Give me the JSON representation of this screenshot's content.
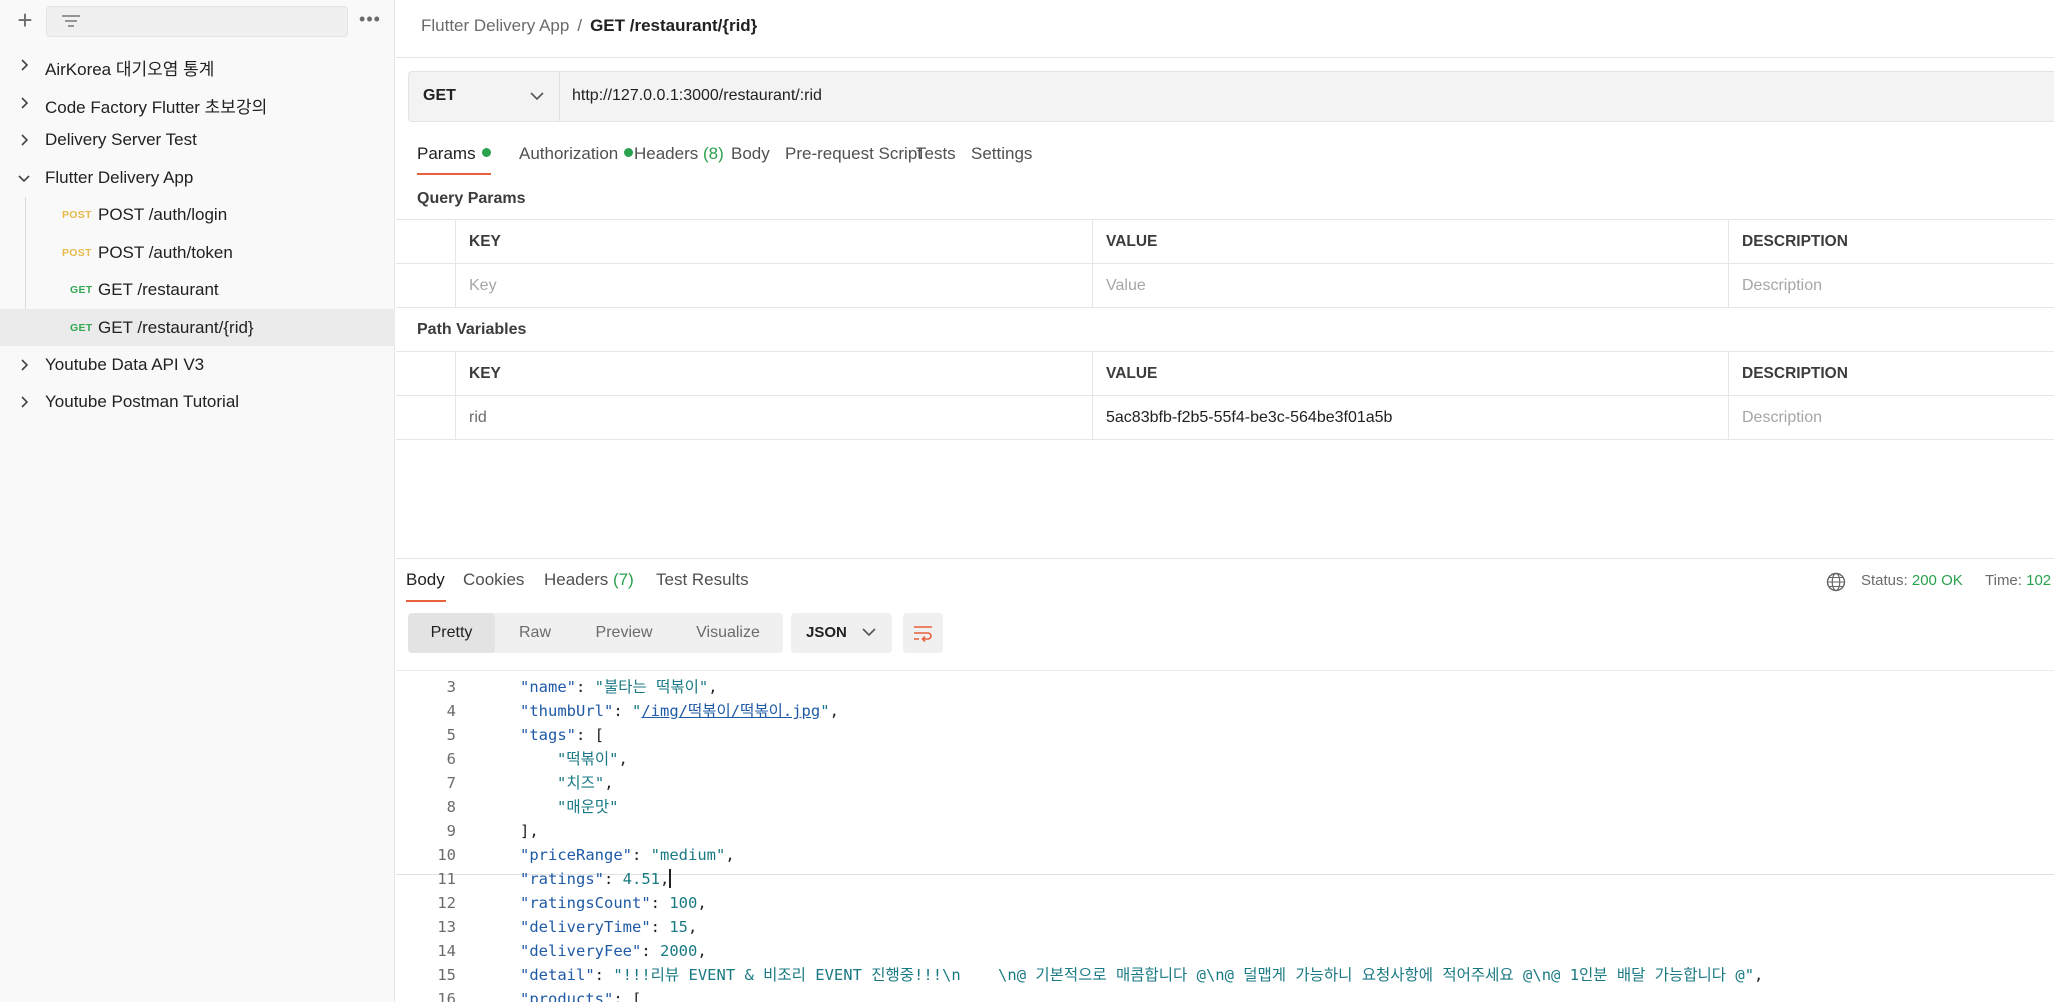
{
  "sidebar": {
    "collections": [
      {
        "label": "AirKorea 대기오염 통계"
      },
      {
        "label": "Code Factory Flutter 초보강의"
      },
      {
        "label": "Delivery Server Test"
      },
      {
        "label": "Flutter Delivery App"
      },
      {
        "label": "Youtube Data API V3"
      },
      {
        "label": "Youtube Postman Tutorial"
      }
    ],
    "requests": [
      {
        "method": "POST",
        "label": "POST /auth/login"
      },
      {
        "method": "POST",
        "label": "POST /auth/token"
      },
      {
        "method": "GET",
        "label": "GET /restaurant"
      },
      {
        "method": "GET",
        "label": "GET /restaurant/{rid}"
      }
    ]
  },
  "breadcrumb": {
    "parent": "Flutter Delivery App",
    "separator": "/",
    "current": "GET /restaurant/{rid}"
  },
  "request": {
    "method": "GET",
    "url": "http://127.0.0.1:3000/restaurant/:rid",
    "tabs": {
      "params": "Params",
      "authorization": "Authorization",
      "headers": "Headers",
      "headers_count": "(8)",
      "body": "Body",
      "prerequest": "Pre-request Script",
      "tests": "Tests",
      "settings": "Settings"
    }
  },
  "query_params": {
    "title": "Query Params",
    "headers": {
      "key": "KEY",
      "value": "VALUE",
      "description": "DESCRIPTION"
    },
    "placeholder": {
      "key": "Key",
      "value": "Value",
      "description": "Description"
    }
  },
  "path_variables": {
    "title": "Path Variables",
    "headers": {
      "key": "KEY",
      "value": "VALUE",
      "description": "DESCRIPTION"
    },
    "row": {
      "key": "rid",
      "value": "5ac83bfb-f2b5-55f4-be3c-564be3f01a5b",
      "description": "Description"
    }
  },
  "response": {
    "tabs": {
      "body": "Body",
      "cookies": "Cookies",
      "headers": "Headers",
      "headers_count": "(7)",
      "test_results": "Test Results"
    },
    "status_label": "Status:",
    "status_value": "200 OK",
    "time_label": "Time:",
    "time_value": "102",
    "views": {
      "pretty": "Pretty",
      "raw": "Raw",
      "preview": "Preview",
      "visualize": "Visualize"
    },
    "format": "JSON"
  },
  "code": {
    "line_numbers": [
      "3",
      "4",
      "5",
      "6",
      "7",
      "8",
      "9",
      "10",
      "11",
      "12",
      "13",
      "14",
      "15",
      "16"
    ],
    "name_key": "\"name\"",
    "name_val": "\"불타는 떡볶이\"",
    "thumb_key": "\"thumbUrl\"",
    "thumb_val": "/img/떡볶이/떡볶이.jpg",
    "tags_key": "\"tags\"",
    "tag1": "\"떡볶이\"",
    "tag2": "\"치즈\"",
    "tag3": "\"매운맛\"",
    "price_key": "\"priceRange\"",
    "price_val": "\"medium\"",
    "ratings_key": "\"ratings\"",
    "ratings_val": "4.51",
    "rcount_key": "\"ratingsCount\"",
    "rcount_val": "100",
    "dtime_key": "\"deliveryTime\"",
    "dtime_val": "15",
    "dfee_key": "\"deliveryFee\"",
    "dfee_val": "2000",
    "detail_key": "\"detail\"",
    "detail_val": "\"!!!리뷰 EVENT & 비조리 EVENT 진행중!!!\\n    \\n@ 기본적으로 매콤합니다 @\\n@ 덜맵게 가능하니 요청사항에 적어주세요 @\\n@ 1인분 배달 가능합니다 @\"",
    "products_key": "\"products\""
  }
}
